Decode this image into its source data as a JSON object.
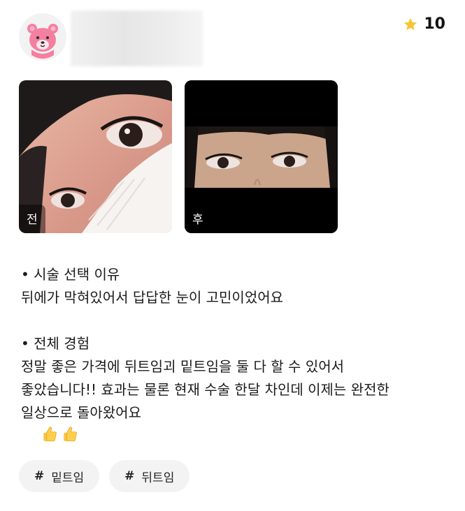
{
  "header": {
    "avatar_icon": "pink-bear-icon",
    "rating": {
      "icon": "star-icon",
      "value": "10",
      "star_color": "#F5C531"
    }
  },
  "photos": [
    {
      "label": "전",
      "kind": "before"
    },
    {
      "label": "후",
      "kind": "after"
    }
  ],
  "content": {
    "section1_title": "• 시술 선택 이유",
    "section1_body": "뒤에가 막혀있어서 답답한 눈이 고민이었어요",
    "section2_title": "• 전체 경험",
    "section2_line1": "정말 좋은 가격에 뒤트임괴 밑트임을 둘 다 할 수 있어서",
    "section2_line2": "좋았습니다!! 효과는 물론 현재 수술 한달 차인데 이제는 완전한",
    "section2_line3": "일상으로 돌아왔어요",
    "emoji": "thumbs-up-icon"
  },
  "tags": [
    {
      "hash": "#",
      "label": "밑트임"
    },
    {
      "hash": "#",
      "label": "뒤트임"
    }
  ]
}
